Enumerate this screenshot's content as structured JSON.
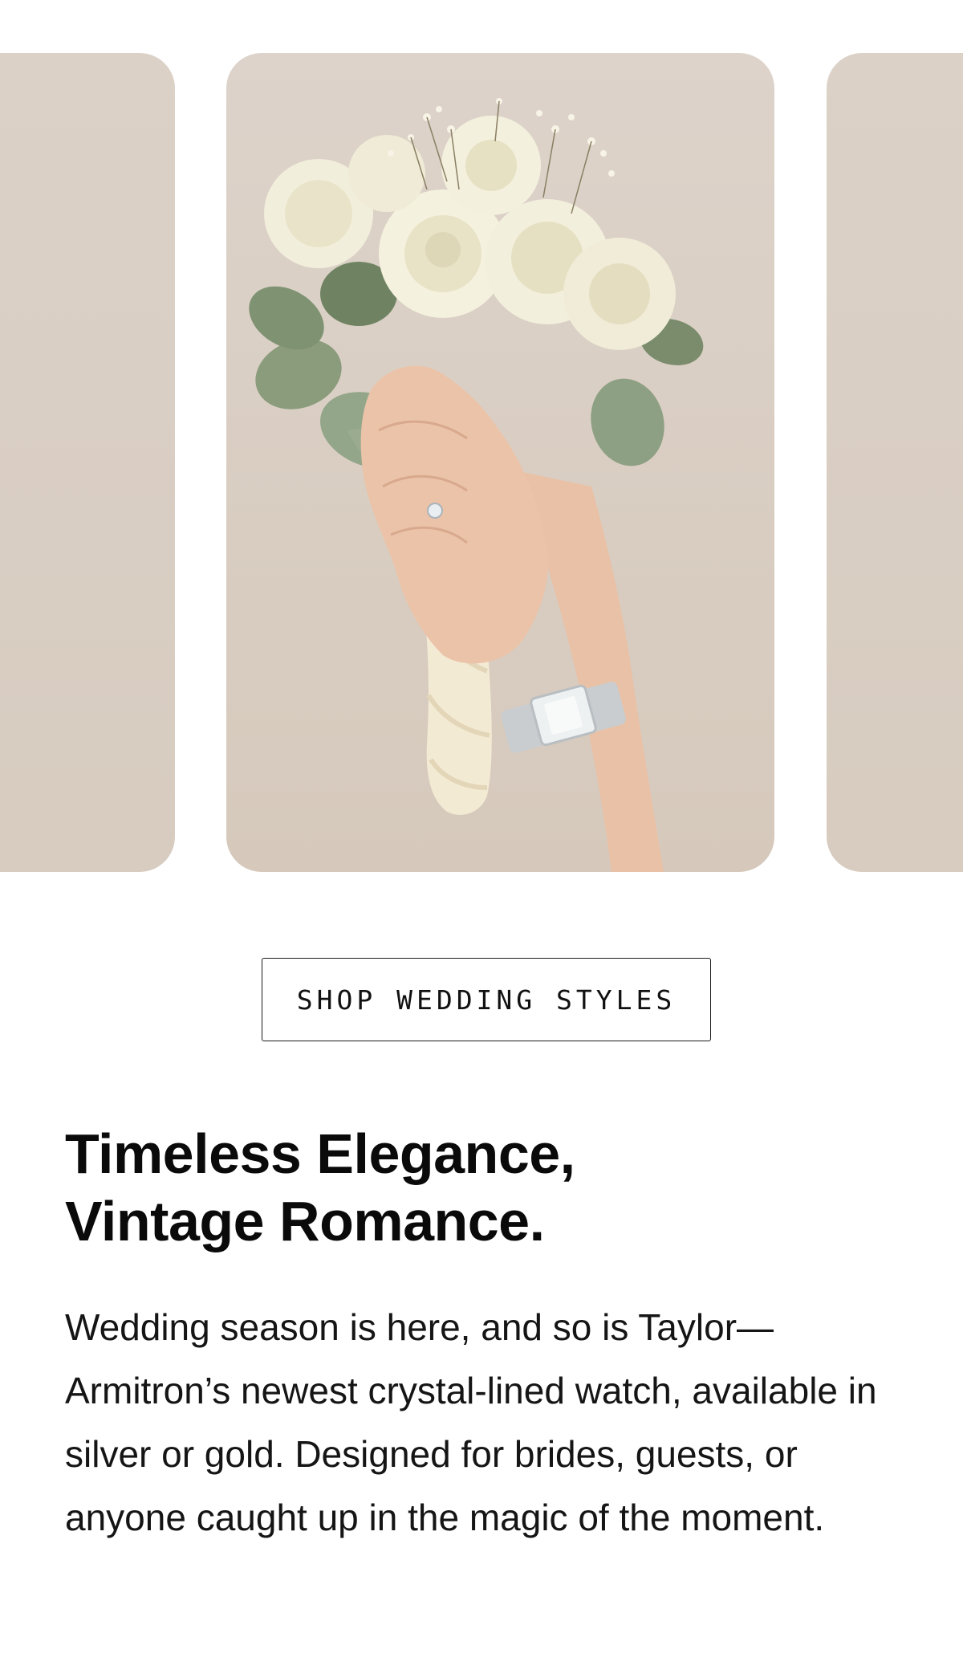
{
  "carousel": {
    "slides": [
      {
        "alt": "Beige backdrop slide"
      },
      {
        "alt": "Hand holding white rose bouquet wearing crystal-lined silver watch"
      },
      {
        "alt": "Beige backdrop slide"
      }
    ]
  },
  "cta": {
    "label": "SHOP WEDDING STYLES"
  },
  "content": {
    "headline_line1": "Timeless Elegance,",
    "headline_line2": "Vintage Romance.",
    "body": "Wedding season is here, and so is Taylor—Armitron’s newest crystal-lined watch, available in silver or gold. Designed for brides, guests, or anyone caught up in the magic of the moment."
  },
  "colors": {
    "slide_background": "#d9cec3",
    "text": "#0c0c0c",
    "button_border": "#1a1a1a"
  }
}
